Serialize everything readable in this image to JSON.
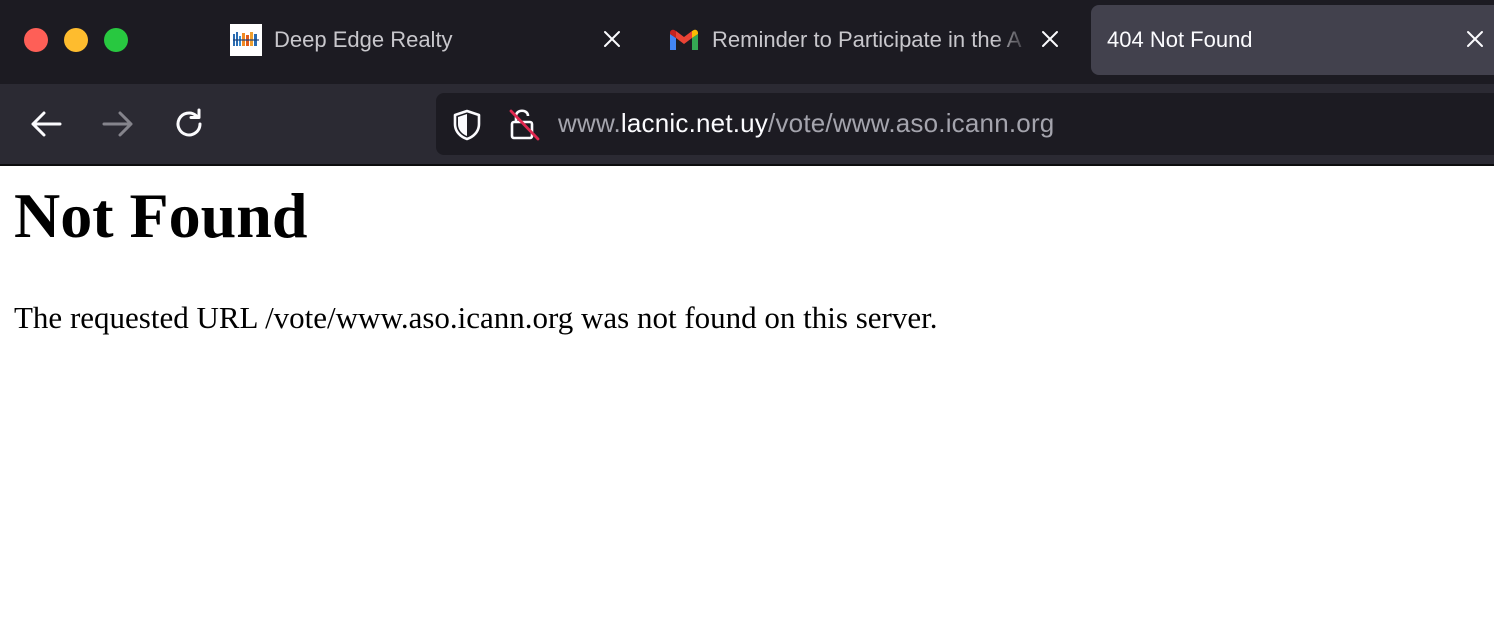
{
  "window": {
    "controls": [
      "close",
      "minimize",
      "maximize"
    ]
  },
  "tabs": [
    {
      "label": "Deep Edge Realty",
      "icon": "deep-edge-favicon",
      "active": false
    },
    {
      "label": "Reminder to Participate in the A",
      "icon": "gmail-icon",
      "active": false
    },
    {
      "label": "404 Not Found",
      "icon": "",
      "active": true
    }
  ],
  "navigation": {
    "back": "back-arrow-icon",
    "forward": "forward-arrow-icon",
    "reload": "reload-icon"
  },
  "address_bar": {
    "prefix": "www.",
    "host": "lacnic.net.uy",
    "path": "/vote/www.aso.icann.org",
    "icons": [
      "tracking-protection-shield-icon",
      "insecure-lock-icon"
    ]
  },
  "page": {
    "heading": "Not Found",
    "message": "The requested URL /vote/www.aso.icann.org was not found on this server."
  },
  "colors": {
    "tabstrip_bg": "#1c1b22",
    "navbar_bg": "#2b2a33",
    "active_tab_bg": "#42414d",
    "insecure_slash": "#e22850"
  }
}
